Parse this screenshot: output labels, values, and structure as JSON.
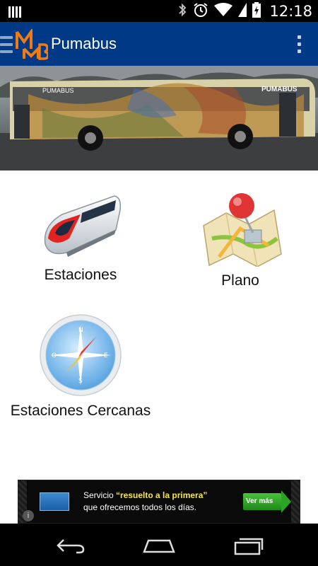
{
  "status_bar": {
    "time": "12:18",
    "icons": [
      "signal-bars-icon",
      "bluetooth-icon",
      "alarm-icon",
      "wifi-icon",
      "battery-icon"
    ]
  },
  "action_bar": {
    "title": "Pumabus",
    "logo": "metrobus-logo",
    "menu_icon": "hamburger-icon",
    "overflow_icon": "overflow-menu-icon",
    "background_color": "#003a87"
  },
  "banner": {
    "bus_front_text": "PUMABUS",
    "bus_rear_text": "PUMABUS"
  },
  "tiles": [
    {
      "label": "Estaciones",
      "icon": "train-icon"
    },
    {
      "label": "Plano",
      "icon": "map-pin-icon"
    },
    {
      "label": "Estaciones Cercanas",
      "icon": "compass-icon"
    }
  ],
  "ad": {
    "line1_prefix": "Servicio ",
    "line1_highlight": "“resuelto a la primera”",
    "line2": "que ofrecemos todos los días.",
    "cta": "Ver más",
    "brand_icon": "amex-card-icon",
    "info_icon": "info-icon"
  },
  "nav_bar": {
    "buttons": [
      "back-icon",
      "home-icon",
      "recent-apps-icon"
    ]
  }
}
